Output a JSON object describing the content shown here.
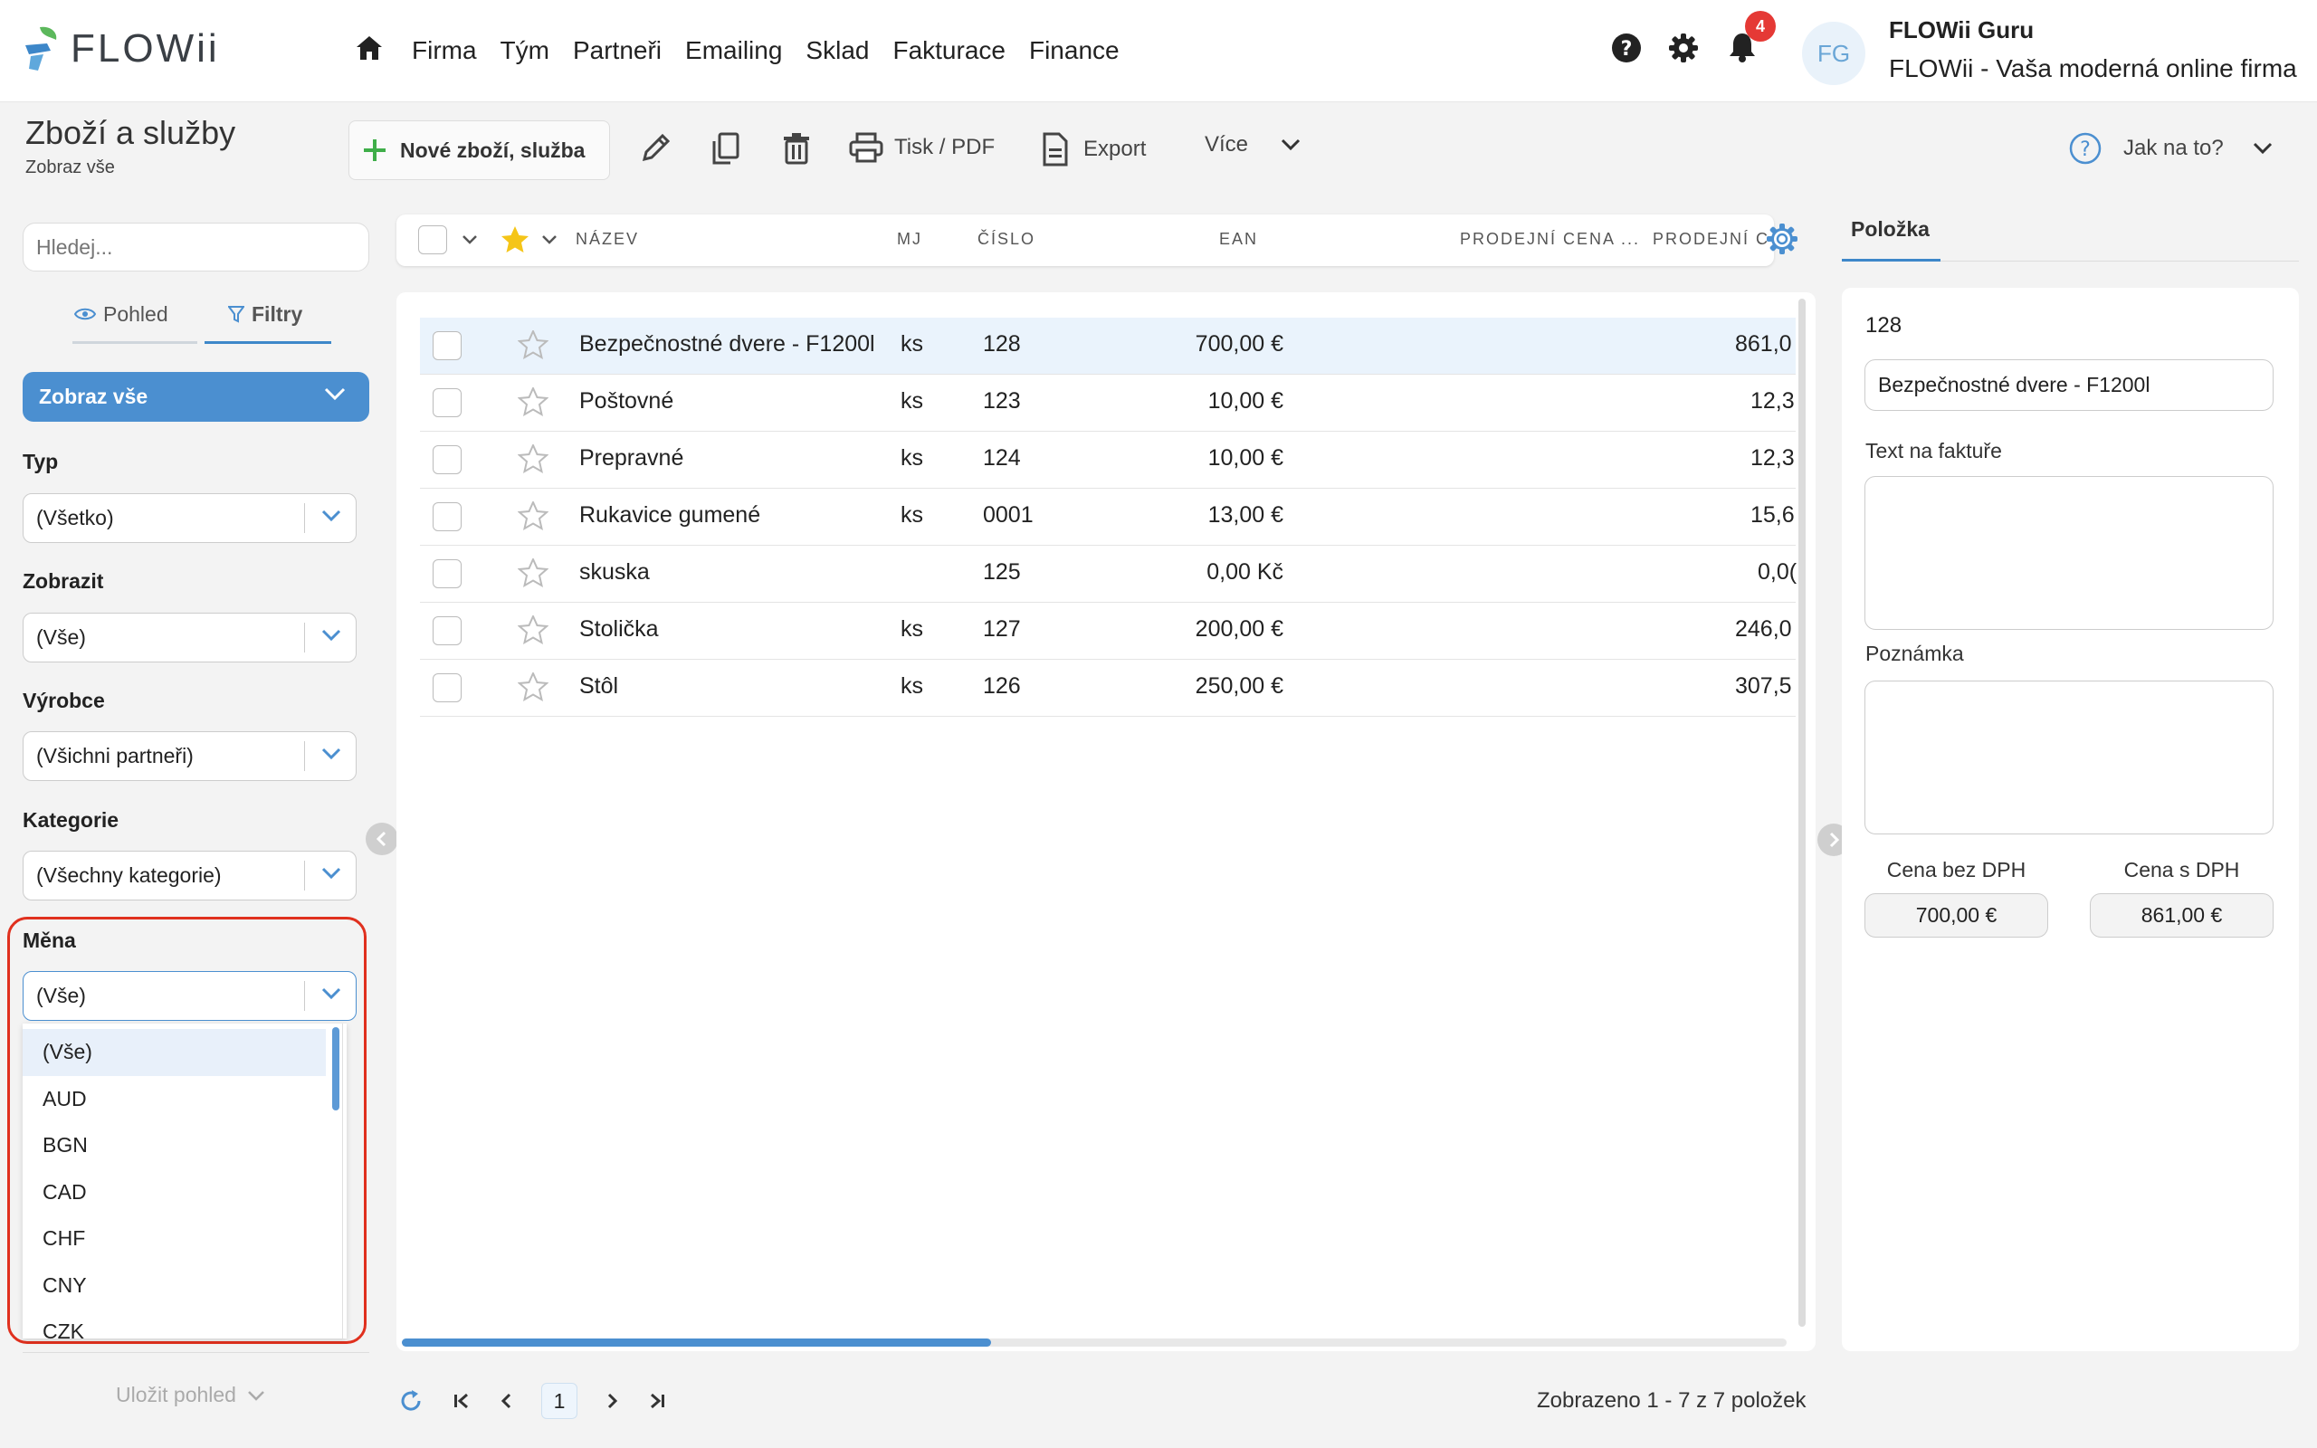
{
  "app": {
    "logo_text": "FLOWii",
    "menu": [
      "Firma",
      "Tým",
      "Partneři",
      "Emailing",
      "Sklad",
      "Fakturace",
      "Finance"
    ],
    "notification_count": "4",
    "avatar_initials": "FG",
    "user_name": "FLOWii Guru",
    "user_company": "FLOWii - Vaša moderná online firma"
  },
  "toolbar": {
    "title": "Zboží a služby",
    "subtitle": "Zobraz vše",
    "new_label": "Nové zboží, služba",
    "print_label": "Tisk / PDF",
    "export_label": "Export",
    "more_label": "Více",
    "help_label": "Jak na to?"
  },
  "sidebar": {
    "search_placeholder": "Hledej...",
    "tab_view": "Pohled",
    "tab_filters": "Filtry",
    "show_all": "Zobraz vše",
    "filters": [
      {
        "label": "Typ",
        "value": "(Všetko)"
      },
      {
        "label": "Zobrazit",
        "value": "(Vše)"
      },
      {
        "label": "Výrobce",
        "value": "(Všichni partneři)"
      },
      {
        "label": "Kategorie",
        "value": "(Všechny kategorie)"
      },
      {
        "label": "Měna",
        "value": "(Vše)"
      }
    ],
    "currency_options": [
      "(Vše)",
      "AUD",
      "BGN",
      "CAD",
      "CHF",
      "CNY",
      "CZK"
    ],
    "save_view": "Uložit pohled"
  },
  "grid": {
    "columns": [
      "NÁZEV",
      "MJ",
      "ČÍSLO",
      "EAN",
      "PRODEJNÍ CENA ...",
      "PRODEJNÍ C"
    ],
    "rows": [
      {
        "name": "Bezpečnostné dvere - F1200l",
        "unit": "ks",
        "code": "128",
        "ean": "",
        "price": "700,00 €",
        "price_vat": "861,0"
      },
      {
        "name": "Poštovné",
        "unit": "ks",
        "code": "123",
        "ean": "",
        "price": "10,00 €",
        "price_vat": "12,3"
      },
      {
        "name": "Prepravné",
        "unit": "ks",
        "code": "124",
        "ean": "",
        "price": "10,00 €",
        "price_vat": "12,3"
      },
      {
        "name": "Rukavice gumené",
        "unit": "ks",
        "code": "0001",
        "ean": "",
        "price": "13,00 €",
        "price_vat": "15,6"
      },
      {
        "name": "skuska",
        "unit": "",
        "code": "125",
        "ean": "",
        "price": "0,00 Kč",
        "price_vat": "0,0("
      },
      {
        "name": "Stolička",
        "unit": "ks",
        "code": "127",
        "ean": "",
        "price": "200,00 €",
        "price_vat": "246,0"
      },
      {
        "name": "Stôl",
        "unit": "ks",
        "code": "126",
        "ean": "",
        "price": "250,00 €",
        "price_vat": "307,5"
      }
    ],
    "page": "1",
    "count_text": "Zobrazeno 1 - 7 z 7 položek"
  },
  "detail": {
    "tab": "Položka",
    "code": "128",
    "name": "Bezpečnostné dvere - F1200l",
    "invoice_text_label": "Text na faktuře",
    "note_label": "Poznámka",
    "price_label": "Cena bez DPH",
    "price_vat_label": "Cena s DPH",
    "price": "700,00 €",
    "price_vat": "861,00 €"
  },
  "colors": {
    "accent": "#4b8fd0",
    "highlight": "#e0301e",
    "badge": "#e53935",
    "star": "#f5c518"
  }
}
